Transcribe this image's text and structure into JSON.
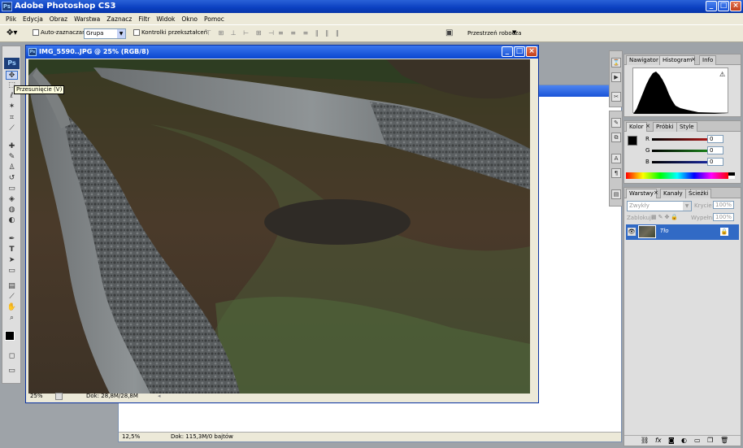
{
  "app": {
    "title": "Adobe Photoshop CS3",
    "logo": "Ps"
  },
  "menu": [
    "Plik",
    "Edycja",
    "Obraz",
    "Warstwa",
    "Zaznacz",
    "Filtr",
    "Widok",
    "Okno",
    "Pomoc"
  ],
  "options": {
    "auto_select_label": "Auto-zaznaczanie:",
    "auto_select_value": "Grupa",
    "transform_label": "Kontrolki przekształceń",
    "workspace_label": "Przestrzeń robocza"
  },
  "toolbox": {
    "logo": "Ps",
    "tooltip": "Przesunięcie (V)",
    "tools": [
      "move-tool-icon",
      "marquee-tool-icon",
      "lasso-tool-icon",
      "magic-wand-icon",
      "crop-tool-icon",
      "slice-tool-icon",
      "healing-brush-icon",
      "brush-tool-icon",
      "clone-stamp-icon",
      "history-brush-icon",
      "eraser-icon",
      "paint-bucket-icon",
      "blur-tool-icon",
      "dodge-tool-icon",
      "pen-tool-icon",
      "type-tool-icon",
      "path-select-icon",
      "shape-tool-icon",
      "notes-tool-icon",
      "eyedropper-icon",
      "hand-tool-icon",
      "zoom-tool-icon"
    ]
  },
  "doc_front": {
    "title": "IMG_5590..JPG @ 25% (RGB/8)",
    "zoom": "25%",
    "doc_info": "Dok: 28,8M/28,8M"
  },
  "doc_back": {
    "zoom": "12,5%",
    "doc_info": "Dok: 115,3M/0 bajtów"
  },
  "navigator_palette": {
    "tabs": [
      "Nawigator",
      "Histogram",
      "Info"
    ],
    "active": 1
  },
  "color_palette": {
    "tabs": [
      "Kolor",
      "Próbki",
      "Style"
    ],
    "channels": [
      {
        "label": "R",
        "value": "0",
        "color": "#d62020"
      },
      {
        "label": "G",
        "value": "0",
        "color": "#20a020"
      },
      {
        "label": "B",
        "value": "0",
        "color": "#2030c0"
      }
    ]
  },
  "layers_palette": {
    "tabs": [
      "Warstwy",
      "Kanały",
      "Ścieżki"
    ],
    "blend_mode": "Zwykły",
    "opacity_label": "Krycie:",
    "opacity_value": "100%",
    "lock_label": "Zablokuj:",
    "fill_label": "Wypełnij:",
    "fill_value": "100%",
    "layer_name": "Tło"
  },
  "colors": {
    "accent": "#316ac5",
    "titlebar": "#0a3fc0"
  }
}
